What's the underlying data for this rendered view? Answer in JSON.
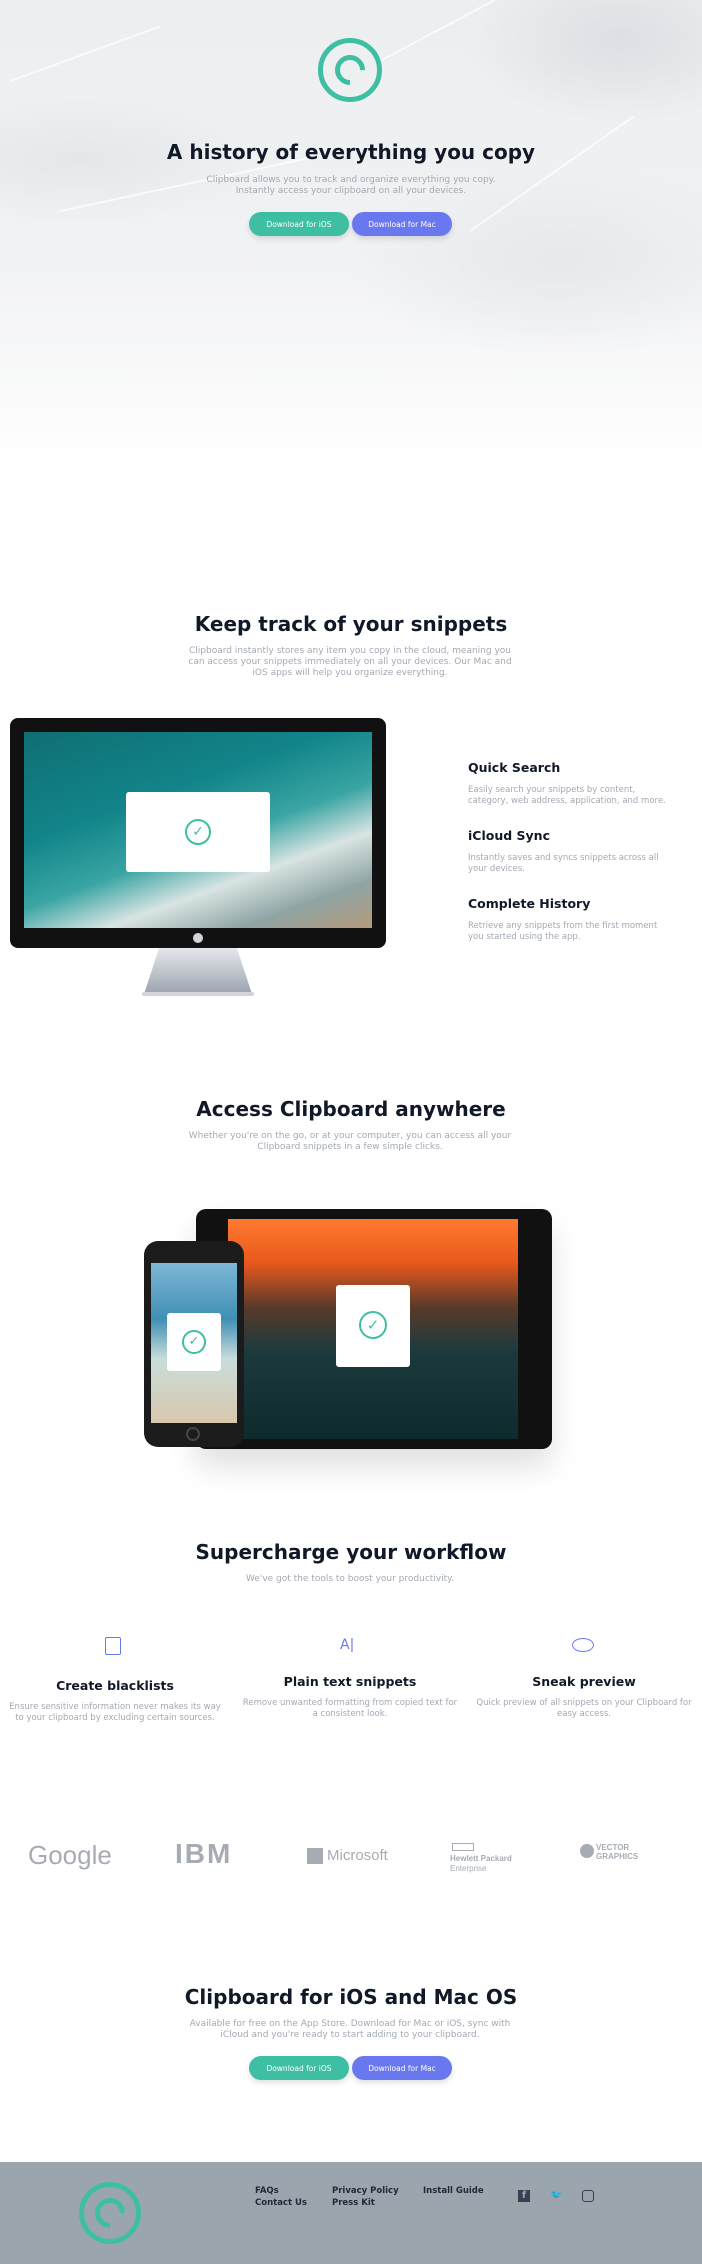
{
  "hero": {
    "title": "A history of everything you copy",
    "subtitle": "Clipboard allows you to track and organize everything you copy. Instantly access your clipboard on all your devices.",
    "ios_button": "Download for iOS",
    "mac_button": "Download for Mac",
    "logo_icon": "copyright-icon"
  },
  "snippets": {
    "title": "Keep track of your snippets",
    "subtitle": "Clipboard instantly stores any item you copy in the cloud, meaning you can access your snippets immediately on all your devices. Our Mac and iOS apps will help you organize everything.",
    "features": [
      {
        "title": "Quick Search",
        "text": "Easily search your snippets by content, category, web address, application, and more."
      },
      {
        "title": "iCloud Sync",
        "text": "Instantly saves and syncs snippets across all your devices."
      },
      {
        "title": "Complete History",
        "text": "Retrieve any snippets from the first moment you started using the app."
      }
    ]
  },
  "access": {
    "title": "Access Clipboard anywhere",
    "subtitle": "Whether you're on the go, or at your computer, you can access all your Clipboard snippets in a few simple clicks."
  },
  "workflow": {
    "title": "Supercharge your workflow",
    "subtitle": "We've got the tools to boost your productivity.",
    "tools": [
      {
        "icon": "blacklist-icon",
        "title": "Create blacklists",
        "text": "Ensure sensitive information never makes its way to your clipboard by excluding certain sources."
      },
      {
        "icon": "text-icon",
        "title": "Plain text snippets",
        "text": "Remove unwanted formatting from copied text for a consistent look."
      },
      {
        "icon": "eye-icon",
        "title": "Sneak preview",
        "text": "Quick preview of all snippets on your Clipboard for easy access."
      }
    ]
  },
  "partners": {
    "google": "Google",
    "ibm": "IBM",
    "microsoft": "Microsoft",
    "hp_line1": "Hewlett Packard",
    "hp_line2": "Enterprise",
    "vector_line1": "VECTOR",
    "vector_line2": "GRAPHICS"
  },
  "cta": {
    "title": "Clipboard for iOS and Mac OS",
    "subtitle": "Available for free on the App Store. Download for Mac or iOS, sync with iCloud and you're ready to start adding to your clipboard.",
    "ios_button": "Download for iOS",
    "mac_button": "Download for Mac"
  },
  "footer": {
    "links": [
      "FAQs",
      "Contact Us",
      "Privacy Policy",
      "Press Kit",
      "Install Guide"
    ],
    "social": [
      "facebook-icon",
      "twitter-icon",
      "instagram-icon"
    ],
    "colors": {
      "accent": "#3ebfa3",
      "mac": "#6a78ef",
      "footer": "#9aa5ad"
    }
  }
}
